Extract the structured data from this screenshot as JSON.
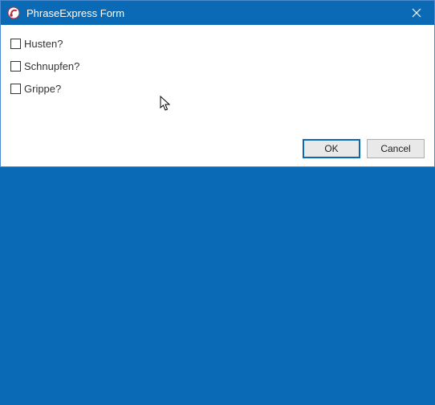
{
  "titlebar": {
    "title": "PhraseExpress Form"
  },
  "checkboxes": {
    "item0": {
      "label": "Husten?"
    },
    "item1": {
      "label": "Schnupfen?"
    },
    "item2": {
      "label": "Grippe?"
    }
  },
  "buttons": {
    "ok": "OK",
    "cancel": "Cancel"
  }
}
